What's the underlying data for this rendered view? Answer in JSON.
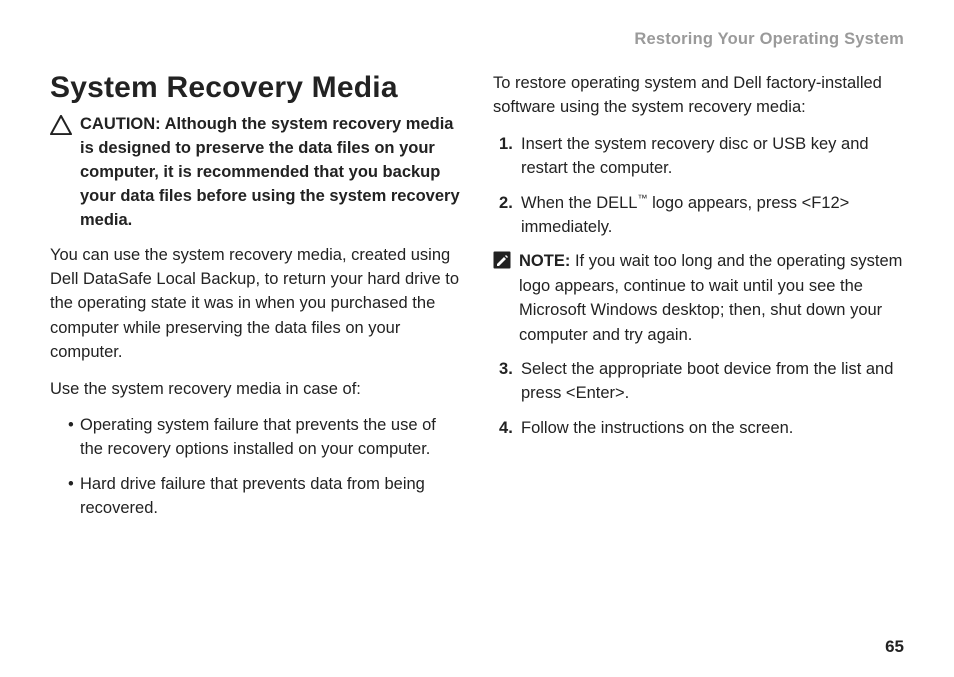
{
  "header": {
    "running_title": "Restoring Your Operating System"
  },
  "left": {
    "title": "System Recovery Media",
    "caution_label": "CAUTION:",
    "caution_text": "Although the system recovery media is designed to preserve the data files on your computer, it is recommended that you backup your data files before using the system recovery media.",
    "para1": "You can use the system recovery media, created using Dell DataSafe Local Backup, to return your hard drive to the operating state it was in when you purchased the computer while preserving the data files on your computer.",
    "para2": "Use the system recovery media in case of:",
    "bullets": [
      "Operating system failure that prevents the use of the recovery options installed on your computer.",
      "Hard drive failure that prevents data from being recovered."
    ]
  },
  "right": {
    "intro": "To restore operating system and Dell factory-installed software using the system recovery media:",
    "step1": "Insert the system recovery disc or USB key and restart the computer.",
    "step2_a": "When the DELL",
    "step2_tm": "™",
    "step2_b": " logo appears, press <F12> immediately.",
    "note_label": "NOTE:",
    "note_text": "If you wait too long and the operating system logo appears, continue to wait until you see the Microsoft Windows desktop; then, shut down your computer and try again.",
    "step3": "Select the appropriate boot device from the list and press <Enter>.",
    "step4": "Follow the instructions on the screen."
  },
  "page_number": "65"
}
